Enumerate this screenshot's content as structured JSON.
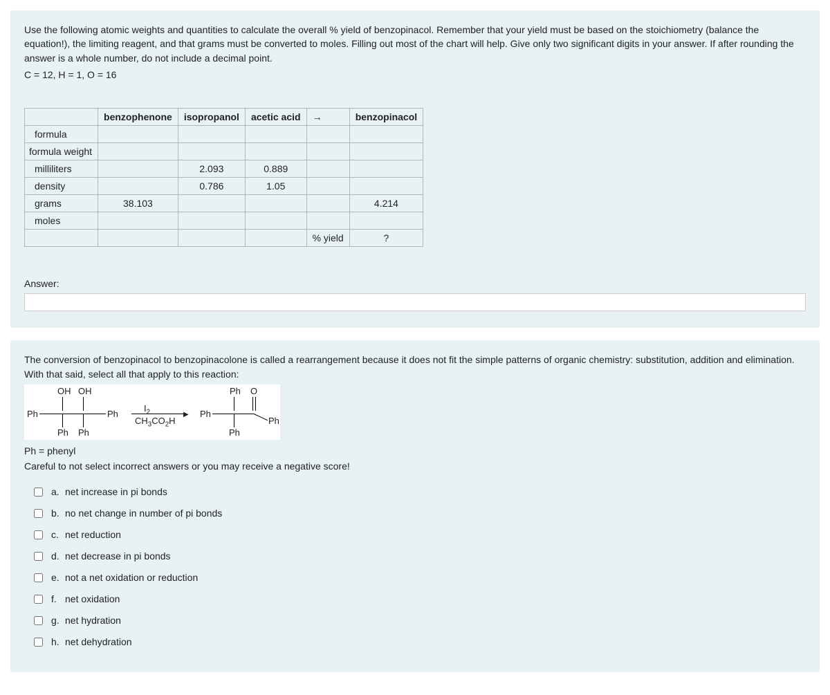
{
  "q1": {
    "instruction": "Use the following atomic weights and quantities to calculate the overall % yield of benzopinacol.  Remember that your yield must be based on the stoichiometry (balance the equation!), the limiting reagent, and that grams must be converted to moles. Filling out most of the chart will help.  Give only two significant digits in your answer.  If after rounding the answer is a whole number, do not include a decimal point.",
    "atomic": "C = 12, H = 1, O = 16",
    "headers": {
      "c1": "benzophenone",
      "c2": "isopropanol",
      "c3": "acetic acid",
      "arrow": "→",
      "c4": "benzopinacol"
    },
    "rows": {
      "formula": "formula",
      "formula_weight": "formula weight",
      "milliliters": "milliliters",
      "density": "density",
      "grams": "grams",
      "moles": "moles"
    },
    "vals": {
      "ml_iso": "2.093",
      "ml_acid": "0.889",
      "dens_iso": "0.786",
      "dens_acid": "1.05",
      "g_benzo": "38.103",
      "g_pinacol": "4.214",
      "pct_yield_label": "% yield",
      "pct_yield": "?"
    },
    "answer_label": "Answer:"
  },
  "q2": {
    "instruction": "The conversion of benzopinacol to benzopinacolone is called a rearrangement because it does not fit the simple patterns of organic chemistry:  substitution, addition and elimination.  With that said, select all that apply to this reaction:",
    "ph_caption": "Ph = phenyl",
    "warning": "Careful to not select incorrect answers or you may receive a negative score!",
    "chem": {
      "OH1": "OH",
      "OH2": "OH",
      "Ph": "Ph",
      "O": "O",
      "I2": "I",
      "I2sub": "2",
      "cat": "CH",
      "cat3": "3",
      "cat2": "CO",
      "cat2sub": "2",
      "catH": "H"
    },
    "options": [
      {
        "letter": "a.",
        "text": "net increase in pi bonds"
      },
      {
        "letter": "b.",
        "text": "no net change in number of pi bonds"
      },
      {
        "letter": "c.",
        "text": "net reduction"
      },
      {
        "letter": "d.",
        "text": "net decrease in pi bonds"
      },
      {
        "letter": "e.",
        "text": "not a net oxidation or reduction"
      },
      {
        "letter": "f.",
        "text": "net oxidation"
      },
      {
        "letter": "g.",
        "text": "net hydration"
      },
      {
        "letter": "h.",
        "text": "net dehydration"
      }
    ]
  }
}
